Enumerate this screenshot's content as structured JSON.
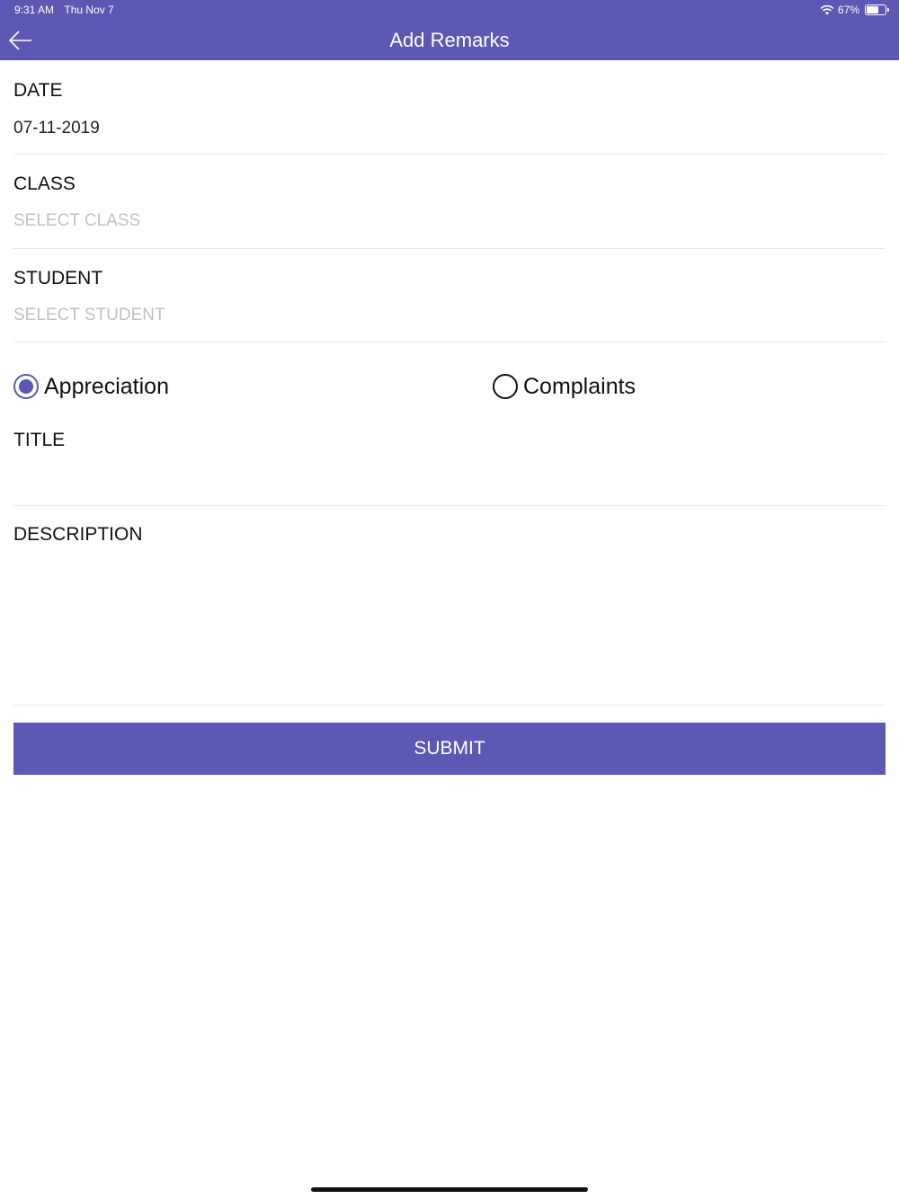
{
  "status_bar": {
    "time": "9:31 AM",
    "date": "Thu Nov 7",
    "battery_text": "67%",
    "battery_level": 0.67,
    "wifi_icon": "wifi-icon"
  },
  "nav": {
    "title": "Add Remarks",
    "back_icon": "back-arrow-icon"
  },
  "form": {
    "date": {
      "label": "DATE",
      "value": "07-11-2019"
    },
    "class": {
      "label": "CLASS",
      "placeholder": "SELECT CLASS"
    },
    "student": {
      "label": "STUDENT",
      "placeholder": "SELECT STUDENT"
    },
    "remark_type": {
      "options": [
        "Appreciation",
        "Complaints"
      ],
      "selected": "Appreciation"
    },
    "title": {
      "label": "TITLE",
      "value": ""
    },
    "description": {
      "label": "DESCRIPTION",
      "value": ""
    },
    "submit_label": "SUBMIT"
  },
  "colors": {
    "accent": "#5b59b3",
    "placeholder": "#c2c2c2",
    "divider": "#e8e8e8"
  }
}
